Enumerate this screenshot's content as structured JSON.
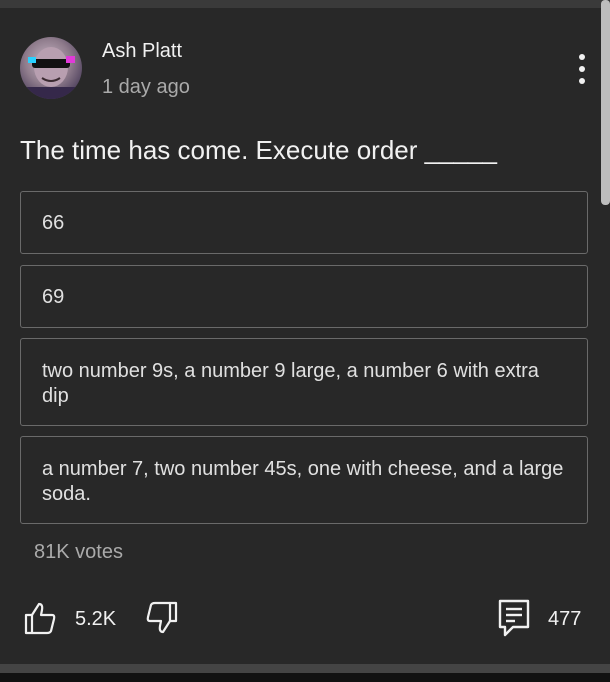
{
  "post": {
    "author": "Ash Platt",
    "time": "1 day ago",
    "text": "The time has come. Execute order _____"
  },
  "poll": {
    "options": [
      "66",
      "69",
      "two number 9s, a number 9 large, a number 6  with extra dip",
      "a number 7, two number 45s, one with cheese, and a large soda."
    ],
    "votes": "81K votes"
  },
  "actions": {
    "likes": "5.2K",
    "comments": "477",
    "icons": [
      "more-vertical-icon",
      "thumbs-up-icon",
      "thumbs-down-icon",
      "comment-icon"
    ]
  },
  "colors": {
    "background": "#282828",
    "text_primary": "#f1f1f1",
    "text_secondary": "#aaaaaa",
    "option_border": "#6a6a6a"
  }
}
